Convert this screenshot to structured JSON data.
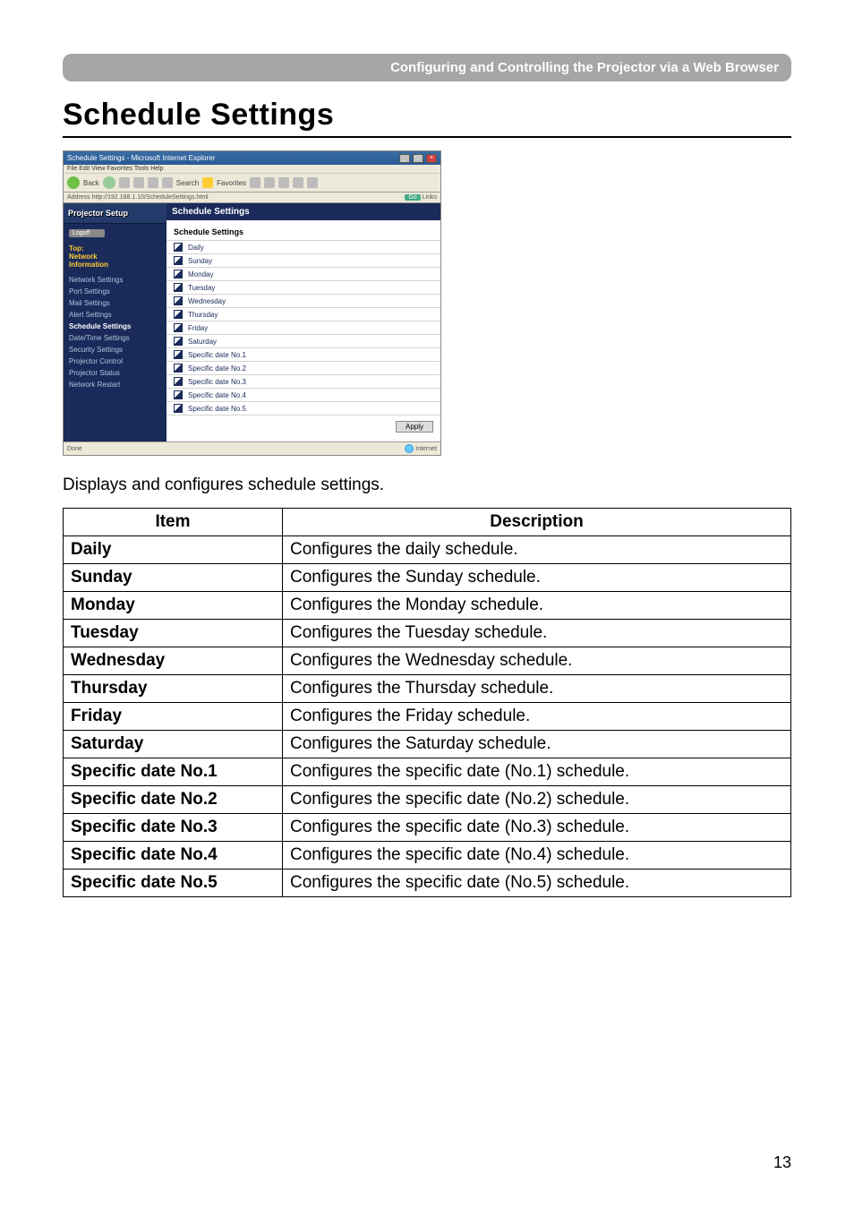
{
  "header_bar": "Configuring and Controlling the Projector via a Web Browser",
  "title": "Schedule Settings",
  "screenshot": {
    "window_title": "Schedule Settings - Microsoft Internet Explorer",
    "menu": "File  Edit  View  Favorites  Tools  Help",
    "back_label": "Back",
    "search_label": "Search",
    "favorites_label": "Favorites",
    "address_label": "Address  http://192.168.1.10/ScheduleSettings.html",
    "go_label": "Go",
    "links_label": "Links",
    "brand": "Projector Setup",
    "logoff": "Logoff",
    "side_top_lines": [
      "Top:",
      "Network",
      "Information"
    ],
    "side_items": [
      "Network Settings",
      "Port Settings",
      "Mail Settings",
      "Alert Settings",
      "Schedule Settings",
      "Date/Time Settings",
      "Security Settings",
      "Projector Control",
      "Projector Status",
      "Network Restart"
    ],
    "side_active_index": 4,
    "main_heading": "Schedule Settings",
    "section_title": "Schedule Settings",
    "rows": [
      "Daily",
      "Sunday",
      "Monday",
      "Tuesday",
      "Wednesday",
      "Thursday",
      "Friday",
      "Saturday",
      "Specific date No.1",
      "Specific date No.2",
      "Specific date No.3",
      "Specific date No.4",
      "Specific date No.5"
    ],
    "apply_label": "Apply",
    "status_left": "Done",
    "status_right": "Internet"
  },
  "intro": "Displays and configures schedule settings.",
  "table": {
    "headers": [
      "Item",
      "Description"
    ],
    "rows": [
      {
        "item": "Daily",
        "desc": "Configures the daily schedule."
      },
      {
        "item": "Sunday",
        "desc": "Configures the Sunday schedule."
      },
      {
        "item": "Monday",
        "desc": "Configures the Monday schedule."
      },
      {
        "item": "Tuesday",
        "desc": "Configures the Tuesday schedule."
      },
      {
        "item": "Wednesday",
        "desc": "Configures the Wednesday schedule."
      },
      {
        "item": "Thursday",
        "desc": "Configures the Thursday schedule."
      },
      {
        "item": "Friday",
        "desc": "Configures the Friday schedule."
      },
      {
        "item": "Saturday",
        "desc": "Configures the Saturday schedule."
      },
      {
        "item": "Specific date No.1",
        "desc": "Configures the specific date (No.1) schedule."
      },
      {
        "item": "Specific date No.2",
        "desc": "Configures the specific date (No.2) schedule."
      },
      {
        "item": "Specific date No.3",
        "desc": "Configures the specific date (No.3) schedule."
      },
      {
        "item": "Specific date No.4",
        "desc": "Configures the specific date (No.4) schedule."
      },
      {
        "item": "Specific date No.5",
        "desc": "Configures the specific date (No.5) schedule."
      }
    ]
  },
  "page_number": "13"
}
